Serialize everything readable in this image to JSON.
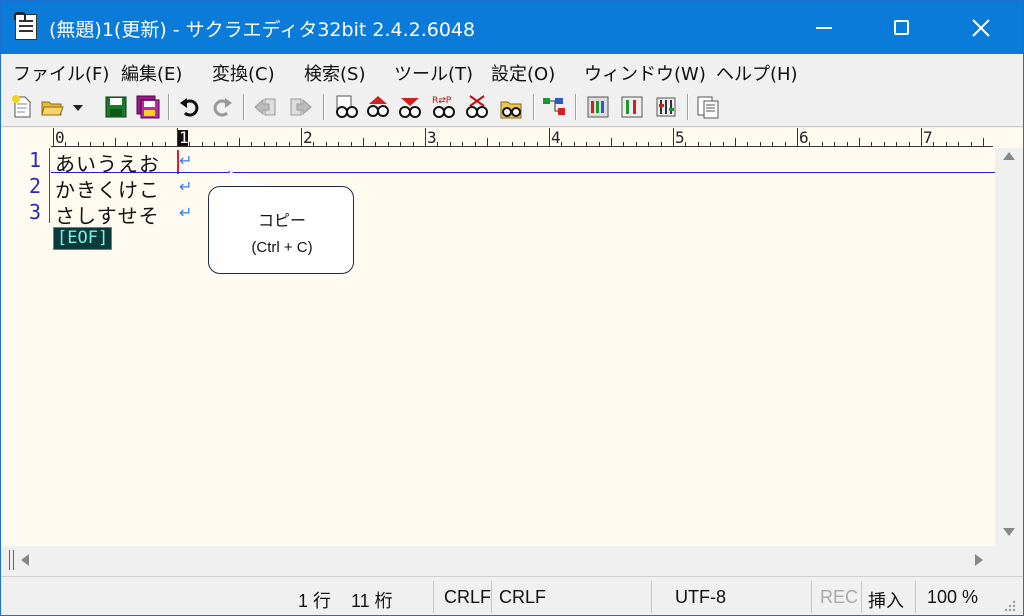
{
  "window": {
    "title": "(無題)1(更新) - サクラエディタ32bit 2.4.2.6048"
  },
  "menu": [
    {
      "label": "ファイル(F)"
    },
    {
      "label": "編集(E)"
    },
    {
      "label": "変換(C)"
    },
    {
      "label": "検索(S)"
    },
    {
      "label": "ツール(T)"
    },
    {
      "label": "設定(O)"
    },
    {
      "label": "ウィンドウ(W)"
    },
    {
      "label": "ヘルプ(H)"
    }
  ],
  "toolbar": {
    "icons": [
      "new-file-icon",
      "open-file-icon",
      "open-dropdown-icon",
      "save-icon",
      "save-all-icon",
      "undo-icon",
      "redo-icon",
      "jump-back-icon",
      "jump-forward-icon",
      "find-icon",
      "find-prev-icon",
      "find-next-icon",
      "replace-icon",
      "clear-highlight-icon",
      "grep-icon",
      "outline-icon",
      "settings-icon",
      "type-settings-icon",
      "font-settings-icon",
      "tag-jump-icon"
    ]
  },
  "ruler": {
    "labels": [
      "0",
      "1",
      "2",
      "3",
      "4",
      "5",
      "6",
      "7"
    ]
  },
  "editor": {
    "lines": [
      {
        "num": "1",
        "text": "あいうえお"
      },
      {
        "num": "2",
        "text": "かきくけこ"
      },
      {
        "num": "3",
        "text": "さしすせそ"
      }
    ],
    "eol_mark": "↵",
    "eof": "[EOF]"
  },
  "callout": {
    "line1": "コピー",
    "line2": "(Ctrl + C)"
  },
  "status": {
    "line": "1 行",
    "column": "11 桁",
    "eol1": "CRLF",
    "eol2": "CRLF",
    "encoding": "UTF-8",
    "rec": "REC",
    "mode": "挿入",
    "zoom": "100 %"
  },
  "colors": {
    "titlebar": "#0a7bd8",
    "editor_bg": "#fffbf0",
    "line_number": "#2a2ab8",
    "cursor": "#e02020"
  }
}
